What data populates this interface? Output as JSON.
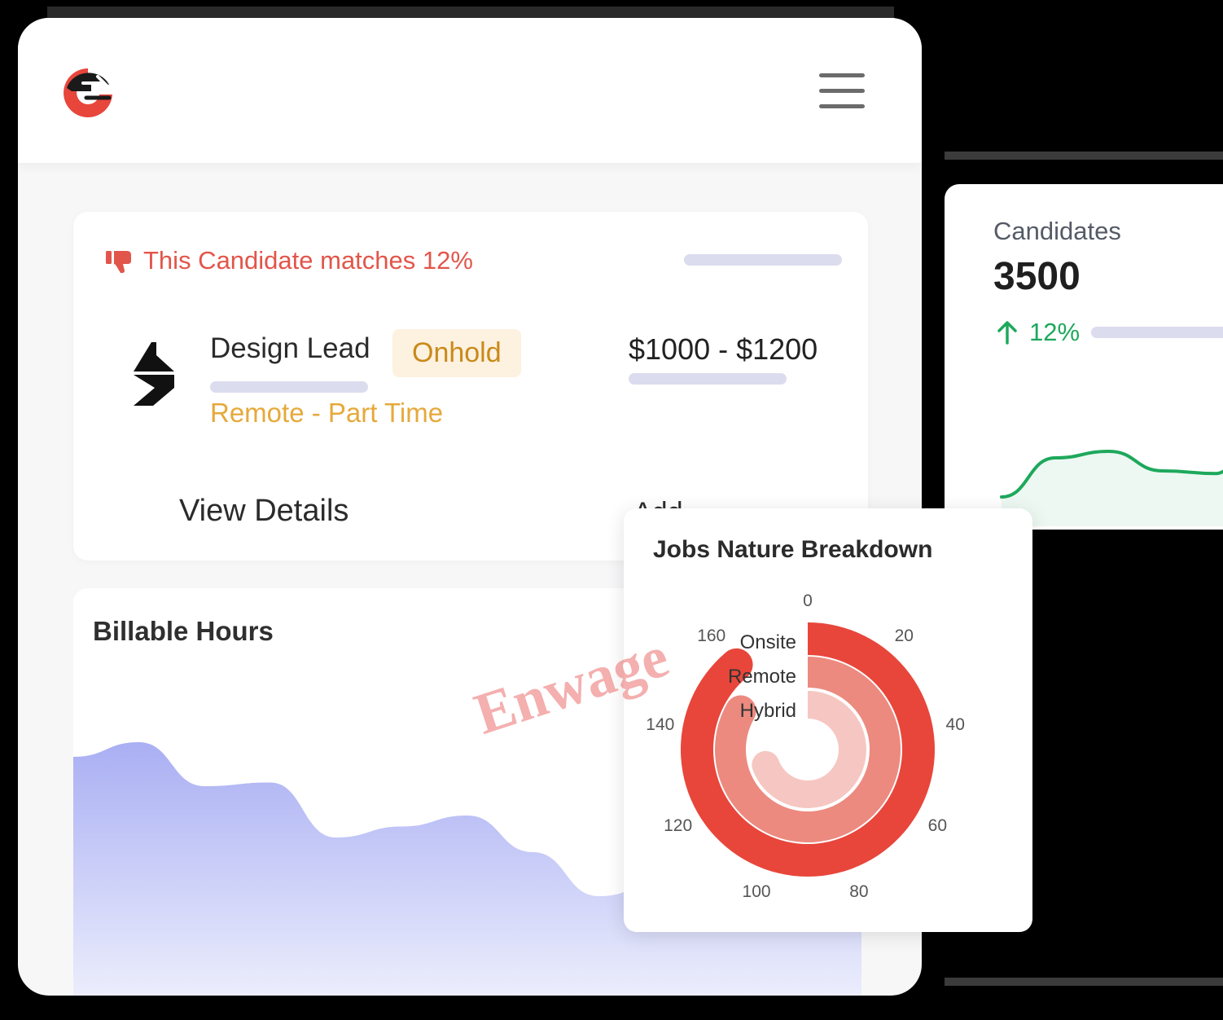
{
  "header": {
    "logo_icon": "enwage-logo-icon",
    "menu_icon": "hamburger-menu-icon"
  },
  "candidate_card": {
    "match_icon": "thumbs-down-icon",
    "match_text": "This Candidate matches 12%",
    "company_icon": "company-logo-icon",
    "job_title": "Design Lead",
    "status": "Onhold",
    "job_type": "Remote - Part Time",
    "salary": "$1000 - $1200",
    "view_details": "View Details",
    "add_partial": "Add"
  },
  "billable": {
    "title": "Billable Hours"
  },
  "candidates": {
    "label": "Candidates",
    "value": "3500",
    "change": "12%",
    "change_icon": "arrow-up-icon"
  },
  "jobs_breakdown": {
    "title": "Jobs Nature Breakdown",
    "categories": [
      "Onsite",
      "Remote",
      "Hybrid"
    ],
    "ticks": [
      "0",
      "20",
      "40",
      "60",
      "80",
      "100",
      "120",
      "140",
      "160"
    ]
  },
  "watermark": "Enwage",
  "colors": {
    "accent_red": "#e8463b",
    "match_red": "#e2554a",
    "status_text": "#c98a1a",
    "status_bg": "#fdf1e0",
    "job_type": "#e6a93a",
    "billable_fill": "#aeb4f4",
    "candidates_green": "#1ea85c"
  },
  "chart_data": [
    {
      "type": "area",
      "title": "Billable Hours",
      "x": [
        0,
        1,
        2,
        3,
        4,
        5,
        6,
        7,
        8,
        9,
        10,
        11,
        12
      ],
      "values": [
        74,
        78,
        66,
        67,
        52,
        55,
        58,
        48,
        36,
        40,
        45,
        50,
        56
      ]
    },
    {
      "type": "line",
      "title": "Candidates",
      "x": [
        0,
        1,
        2,
        3,
        4,
        5
      ],
      "values": [
        10,
        40,
        45,
        30,
        28,
        95
      ]
    },
    {
      "type": "bar",
      "title": "Jobs Nature Breakdown",
      "categories": [
        "Onsite",
        "Remote",
        "Hybrid"
      ],
      "values": [
        160,
        150,
        125
      ],
      "ylim": [
        0,
        180
      ]
    }
  ]
}
